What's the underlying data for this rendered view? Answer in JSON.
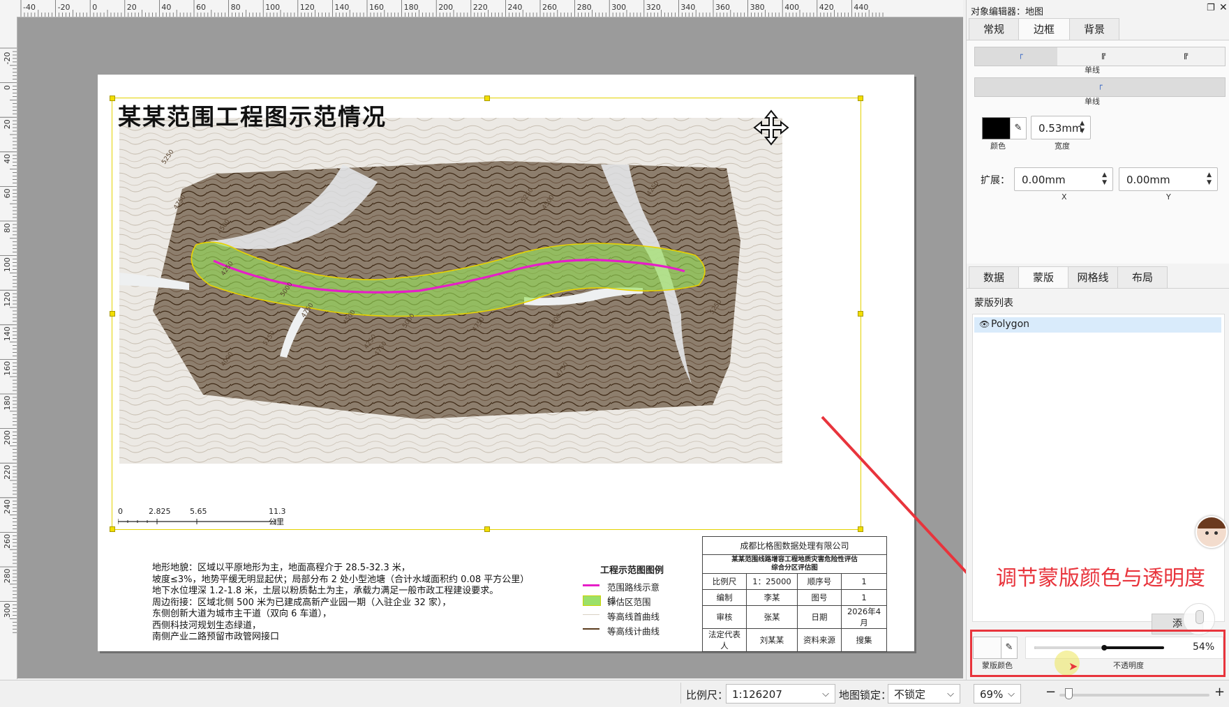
{
  "ruler": {
    "top_ticks": [
      "-40",
      "-20",
      "0",
      "20",
      "40",
      "60",
      "80",
      "100",
      "120",
      "140",
      "160",
      "180",
      "200",
      "220",
      "240",
      "260",
      "280",
      "300",
      "320",
      "340",
      "360",
      "380",
      "400",
      "420",
      "440"
    ],
    "left_ticks": [
      "-20",
      "0",
      "20",
      "40",
      "60",
      "80",
      "100",
      "120",
      "140",
      "160",
      "180",
      "200",
      "220",
      "240",
      "260",
      "280",
      "300"
    ]
  },
  "map": {
    "title": "某某范围工程图示范情况",
    "scale_labels": [
      "0",
      "2.825",
      "5.65",
      "11.3公里"
    ],
    "contour_labels": [
      "5250",
      "4750",
      "4500",
      "4250",
      "5000",
      "5250",
      "4750",
      "4000",
      "4500",
      "4250",
      "4750",
      "5000",
      "4750",
      "5250",
      "4500",
      "5000",
      "4750",
      "4250",
      "5250"
    ]
  },
  "info_lines": [
    "地形地貌：区域以平原地形为主，地面高程介于 28.5-32.3 米，",
    "坡度≤3%，地势平缓无明显起伏；局部分布 2 处小型池塘（合计水域面积约 0.08 平方公里）",
    "地下水位埋深 1.2-1.8 米，土层以粉质黏土为主，承载力满足一般市政工程建设要求。",
    "周边衔接：区域北侧 500 米为已建成高新产业园一期（入驻企业 32 家），",
    "东侧创新大道为城市主干道（双向 6 车道），",
    "西侧科技河规划生态绿道，",
    "南侧产业二路预留市政管网接口"
  ],
  "legend": {
    "title": "工程示范图图例",
    "items": [
      {
        "label": "范围路线示意线",
        "color": "#e61ec8"
      },
      {
        "label": "评估区范围",
        "color": "#9be06a"
      },
      {
        "label": "等高线首曲线",
        "color": "#e0d9cc"
      },
      {
        "label": "等高线计曲线",
        "color": "#5a3b1e"
      }
    ]
  },
  "titleblock": {
    "company": "成都比格图数据处理有限公司",
    "subtitle1": "某某范围线路增容工程地质灾害危险性评估",
    "subtitle2": "综合分区评估图",
    "rows": [
      [
        "比例尺",
        "1：25000",
        "顺序号",
        "1"
      ],
      [
        "编制",
        "李某",
        "图号",
        "1"
      ],
      [
        "审核",
        "张某",
        "日期",
        "2026年4月"
      ],
      [
        "法定代表人",
        "刘某某",
        "资料来源",
        "搜集"
      ]
    ]
  },
  "panel": {
    "title": "对象编辑器：地图",
    "top_tabs": [
      "常规",
      "边框",
      "背景"
    ],
    "active_top_tab": "边框",
    "line_style_caption": "单线",
    "line_style_caption2": "单线",
    "color_label": "颜色",
    "width_value": "0.53mm",
    "width_label": "宽度",
    "expand_label": "扩展：",
    "expand_x": "0.00mm",
    "expand_y": "0.00mm",
    "x_label": "X",
    "y_label": "Y",
    "bottom_tabs": [
      "数据",
      "蒙版",
      "网格线",
      "布局"
    ],
    "active_bottom_tab": "蒙版",
    "mask_list_title": "蒙版列表",
    "mask_items": [
      "Polygon"
    ],
    "mask_color_label": "蒙版颜色",
    "opacity_label": "不透明度",
    "opacity_value": "54%",
    "opacity_fraction": 0.54,
    "partial_button": "添"
  },
  "annotation": {
    "text": "调节蒙版颜色与透明度",
    "color": "#e8343c"
  },
  "status": {
    "scale_label": "比例尺：",
    "scale_value": "1:126207",
    "lock_label": "地图锁定：",
    "lock_value": "不锁定",
    "zoom_value": "69%",
    "minus": "−",
    "plus": "+"
  }
}
